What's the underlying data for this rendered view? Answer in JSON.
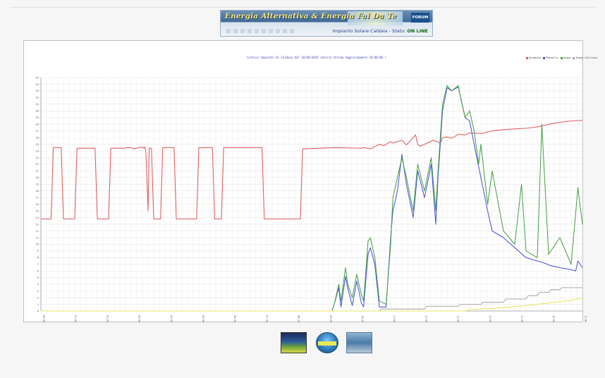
{
  "header": {
    "banner_title": "Energia Alternativa & Energia Fai Da Te",
    "banner_subtitle": "Impianto Solare Caldaia - Stato:",
    "banner_status": "ON LINE",
    "banner_badge": "FORUM"
  },
  "footer": {
    "logos": [
      "logo-energia",
      "logo-circle",
      "logo-fai-da-te"
    ]
  },
  "colors": {
    "accumulo": "#e05a5a",
    "pannelli": "#4a55d6",
    "acqua": "#4aa04a",
    "acqua_utilizzo": "#aaaaaa",
    "fifth": "#e8e860",
    "grid": "#e8e8e8"
  },
  "chart_data": {
    "type": "line",
    "title": "Grafico Impianto Di Caldaia del 16/04/2016 (Orario Ultimo Aggiornamento 18:00:00 )",
    "legend_placement": "top-right",
    "grid": true,
    "ylim": [
      0,
      35
    ],
    "yticks": [
      0,
      1,
      2,
      3,
      4,
      5,
      6,
      7,
      8,
      9,
      10,
      11,
      12,
      13,
      14,
      15,
      16,
      17,
      18,
      19,
      20,
      21,
      22,
      23,
      24,
      25,
      26,
      27,
      28,
      29,
      30,
      31,
      32,
      33,
      34,
      35
    ],
    "xlim": [
      0,
      24
    ],
    "xtick_labels": [
      "00:00",
      "01:00",
      "02:00",
      "03:00",
      "04:00",
      "05:00",
      "06:00",
      "07:00",
      "08:00",
      "09:00",
      "10:00",
      "11:00",
      "12:00",
      "13:00",
      "14:00",
      "15:00",
      "16:00",
      "17:00"
    ],
    "series": [
      {
        "name": "Accumulo",
        "color": "#e05a5a",
        "x": [
          0,
          0.45,
          0.55,
          0.9,
          1.0,
          1.5,
          1.6,
          2.4,
          2.5,
          3.0,
          3.1,
          3.7,
          3.8,
          4.0,
          4.1,
          4.5,
          4.55,
          4.6,
          4.65,
          4.75,
          4.8,
          4.9,
          5.0,
          5.3,
          5.4,
          5.9,
          6.0,
          6.9,
          7.0,
          7.6,
          7.7,
          8.0,
          8.1,
          9.8,
          9.9,
          11.5,
          11.6,
          13.0,
          13.1,
          14.2,
          14.3,
          14.5,
          14.6,
          15.0,
          15.2,
          15.5,
          15.6,
          16.0,
          16.2,
          16.6,
          16.7,
          16.8,
          17.0,
          17.4,
          17.7,
          17.8,
          18.0,
          18.2,
          18.5,
          18.8,
          19.0,
          19.5,
          20.0,
          20.5,
          21.0,
          21.5,
          22.0,
          22.5,
          23.0,
          23.5,
          24.0
        ],
        "y": [
          13.8,
          13.8,
          24.5,
          24.5,
          13.8,
          13.8,
          24.4,
          24.4,
          13.8,
          13.8,
          24.4,
          24.4,
          24.5,
          24.5,
          24.3,
          24.6,
          24.4,
          24.6,
          24.0,
          15.0,
          24.4,
          24.4,
          13.8,
          13.8,
          24.5,
          24.5,
          13.8,
          13.8,
          24.5,
          24.5,
          13.8,
          13.8,
          24.5,
          24.5,
          13.8,
          13.8,
          24.3,
          24.5,
          24.5,
          24.4,
          24.5,
          24.4,
          24.3,
          25.0,
          24.8,
          25.4,
          25.2,
          25.6,
          24.9,
          26.4,
          25.0,
          24.7,
          25.0,
          25.6,
          25.2,
          26.0,
          26.1,
          25.9,
          26.5,
          26.4,
          26.7,
          26.6,
          27.0,
          27.2,
          27.3,
          27.4,
          27.6,
          28.0,
          28.3,
          28.5,
          28.6
        ]
      },
      {
        "name": "Pannelli",
        "color": "#4a55d6",
        "x": [
          0,
          12.9,
          13.0,
          13.2,
          13.3,
          13.5,
          13.6,
          13.8,
          14.0,
          14.2,
          14.3,
          14.5,
          14.6,
          14.8,
          15.0,
          15.3,
          15.5,
          15.6,
          15.8,
          16.0,
          16.2,
          16.5,
          16.7,
          17.0,
          17.3,
          17.5,
          17.6,
          17.8,
          18.0,
          18.2,
          18.5,
          18.8,
          19.0,
          19.2,
          19.5,
          19.8,
          20.0,
          20.5,
          21.0,
          21.5,
          22.0,
          22.3,
          22.6,
          23.0,
          23.5,
          23.7,
          23.8,
          24.0
        ],
        "y": [
          0,
          0,
          1.0,
          3.5,
          0.6,
          5.2,
          3.4,
          0.8,
          4.5,
          1.2,
          0.6,
          8.5,
          9.5,
          7.0,
          0.6,
          0.6,
          11.0,
          15.0,
          18.0,
          23.5,
          19.0,
          14.0,
          21.0,
          17.0,
          22.0,
          13.0,
          20.0,
          30.0,
          33.5,
          33.0,
          33.6,
          29.0,
          28.5,
          25.0,
          20.0,
          15.0,
          12.0,
          11.0,
          9.5,
          8.0,
          7.5,
          7.2,
          6.8,
          6.5,
          6.2,
          6.0,
          7.5,
          6.5
        ]
      },
      {
        "name": "Acqua",
        "color": "#4aa04a",
        "x": [
          0,
          12.9,
          13.0,
          13.2,
          13.3,
          13.5,
          13.6,
          13.8,
          14.0,
          14.2,
          14.3,
          14.5,
          14.6,
          14.8,
          15.0,
          15.3,
          15.5,
          15.6,
          15.8,
          16.0,
          16.2,
          16.5,
          16.7,
          17.0,
          17.3,
          17.5,
          17.6,
          17.8,
          18.0,
          18.2,
          18.5,
          18.6,
          18.8,
          19.0,
          19.2,
          19.4,
          19.5,
          19.8,
          20.0,
          20.5,
          21.0,
          21.3,
          21.5,
          22.0,
          22.2,
          22.5,
          23.0,
          23.5,
          23.8,
          24.0
        ],
        "y": [
          0,
          0,
          1.0,
          4.0,
          1.5,
          6.5,
          4.0,
          2.0,
          5.5,
          2.5,
          1.5,
          10.5,
          11.0,
          8.0,
          1.5,
          1.0,
          10.0,
          17.0,
          20.0,
          23.0,
          20.0,
          15.0,
          22.0,
          18.0,
          23.0,
          15.0,
          21.0,
          31.0,
          33.8,
          33.0,
          33.8,
          32.0,
          29.0,
          30.0,
          27.0,
          22.0,
          25.0,
          16.0,
          21.0,
          12.0,
          10.0,
          19.0,
          9.0,
          8.0,
          28.0,
          8.5,
          11.0,
          7.0,
          18.5,
          13.0
        ]
      },
      {
        "name": "Acqua Utilizzo",
        "color": "#aaaaaa",
        "x": [
          0,
          15.0,
          15.1,
          17.0,
          17.1,
          18.5,
          18.6,
          19.5,
          19.6,
          20.5,
          20.6,
          21.5,
          21.6,
          22.0,
          22.1,
          22.5,
          22.6,
          23.0,
          23.1,
          24.0
        ],
        "y": [
          0,
          0,
          0.3,
          0.3,
          0.7,
          0.7,
          1.0,
          1.0,
          1.3,
          1.3,
          1.8,
          1.8,
          2.3,
          2.3,
          2.8,
          2.8,
          3.2,
          3.2,
          3.5,
          3.5
        ]
      },
      {
        "name": "",
        "color": "#e8e860",
        "x": [
          0,
          18.8,
          19.0,
          20.5,
          21.5,
          22.5,
          23.5,
          24.0
        ],
        "y": [
          0,
          0,
          0.2,
          0.5,
          0.8,
          1.2,
          1.6,
          2.0
        ]
      }
    ]
  }
}
